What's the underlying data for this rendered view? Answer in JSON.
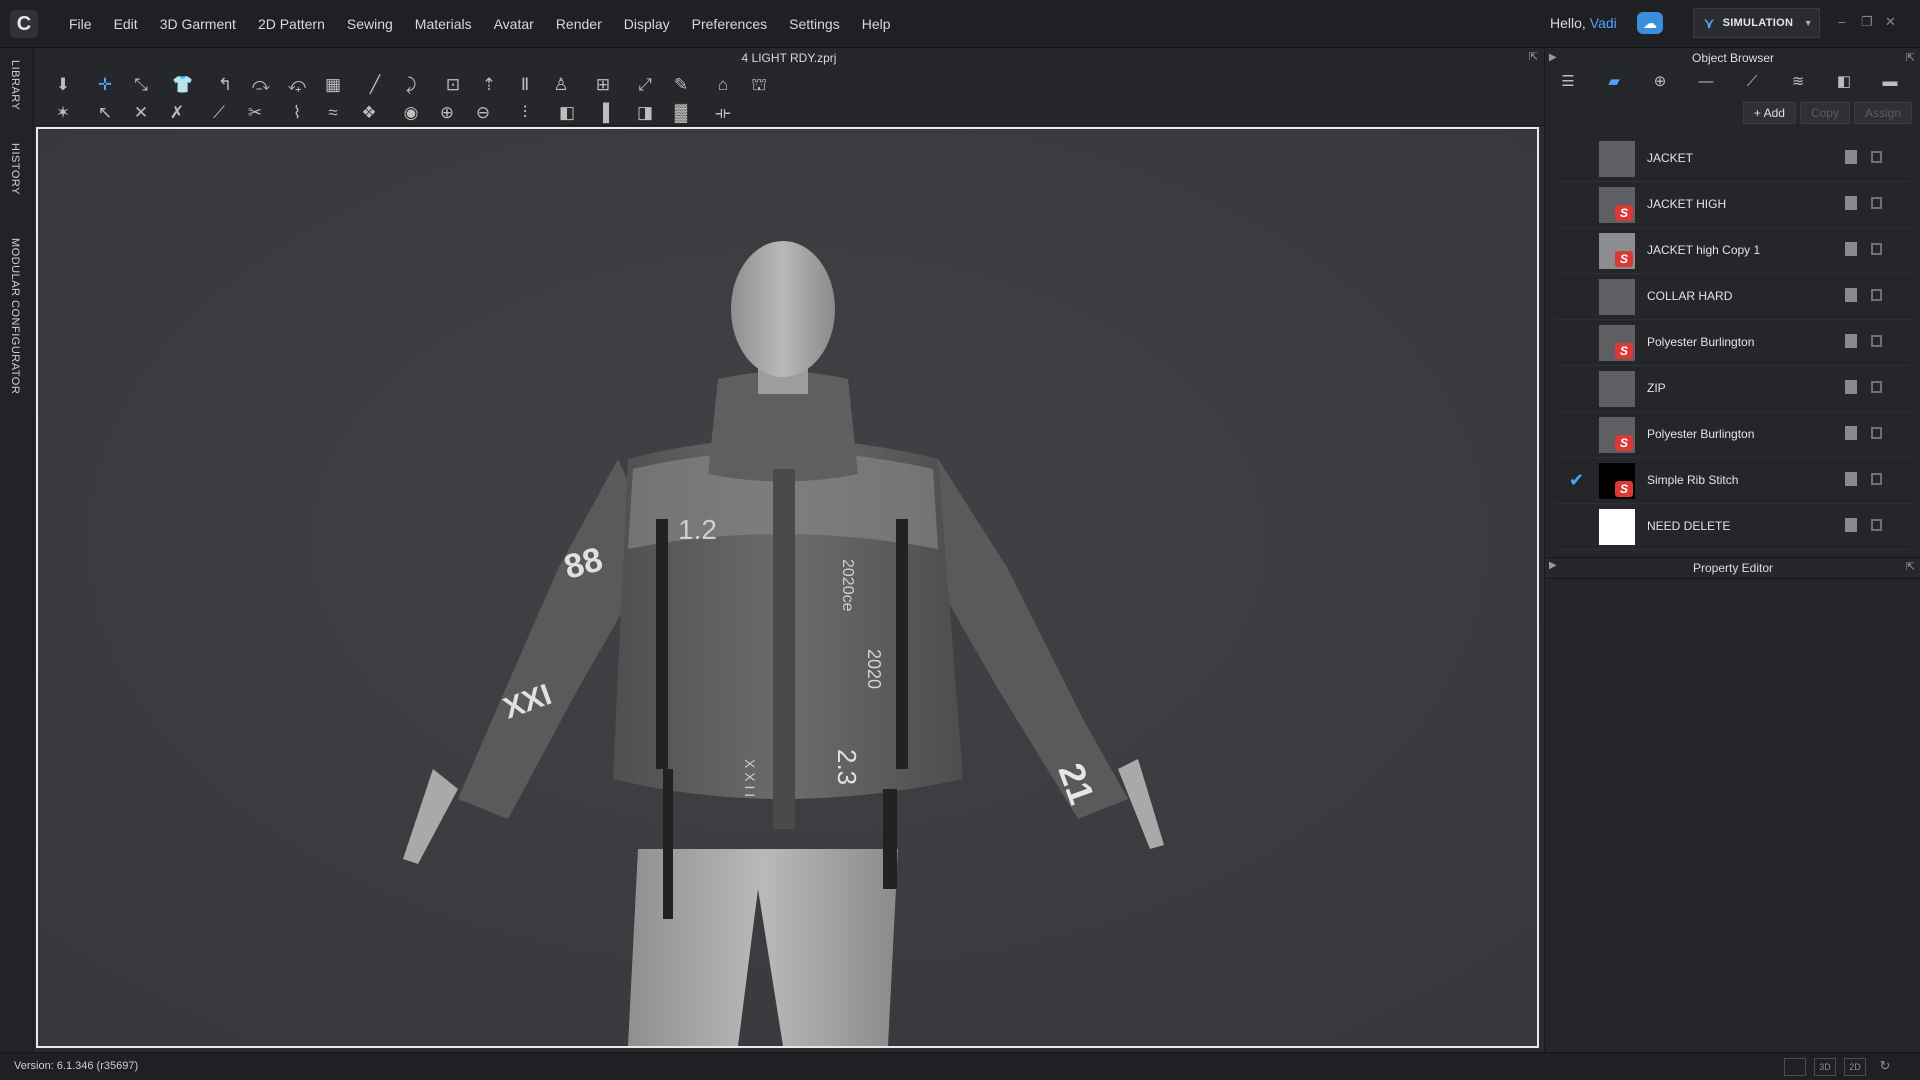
{
  "app": {
    "menu": [
      "File",
      "Edit",
      "3D Garment",
      "2D Pattern",
      "Sewing",
      "Materials",
      "Avatar",
      "Render",
      "Display",
      "Preferences",
      "Settings",
      "Help"
    ],
    "greeting": "Hello,",
    "username": "Vadi",
    "mode": "SIMULATION",
    "window_controls": [
      "–",
      "❐",
      "✕"
    ]
  },
  "left_tabs": [
    "LIBRARY",
    "HISTORY",
    "MODULAR CONFIGURATOR"
  ],
  "document": {
    "title": "4 LIGHT RDY.zprj"
  },
  "object_browser": {
    "title": "Object Browser",
    "actions": {
      "add": "+ Add",
      "copy": "Copy",
      "assign": "Assign"
    },
    "materials": [
      {
        "name": "JACKET",
        "thumb": "#5e5f63",
        "logo": false,
        "checked": false
      },
      {
        "name": "JACKET HIGH",
        "thumb": "#5e5f63",
        "logo": true,
        "checked": false
      },
      {
        "name": "JACKET high Copy 1",
        "thumb": "#8c8d90",
        "logo": true,
        "checked": false
      },
      {
        "name": "COLLAR HARD",
        "thumb": "#5e5f63",
        "logo": false,
        "checked": false
      },
      {
        "name": "Polyester Burlington",
        "thumb": "#5e5f63",
        "logo": true,
        "checked": false
      },
      {
        "name": "ZIP",
        "thumb": "#5e5f63",
        "logo": false,
        "checked": false
      },
      {
        "name": "Polyester Burlington",
        "thumb": "#5e5f63",
        "logo": true,
        "checked": false
      },
      {
        "name": "Simple Rib Stitch",
        "thumb": "#000000",
        "logo": true,
        "checked": true
      },
      {
        "name": "NEED DELETE",
        "thumb": "#ffffff",
        "logo": false,
        "checked": false
      }
    ]
  },
  "property_editor": {
    "title": "Property Editor"
  },
  "status": {
    "version": "Version: 6.1.346 (r35697)",
    "view_buttons": [
      "",
      "3D",
      "2D",
      "↻"
    ]
  },
  "garment_labels": [
    "88",
    "1.2",
    "XXI",
    "2.3",
    "21",
    "2020ce",
    "X X I I",
    "2020"
  ]
}
